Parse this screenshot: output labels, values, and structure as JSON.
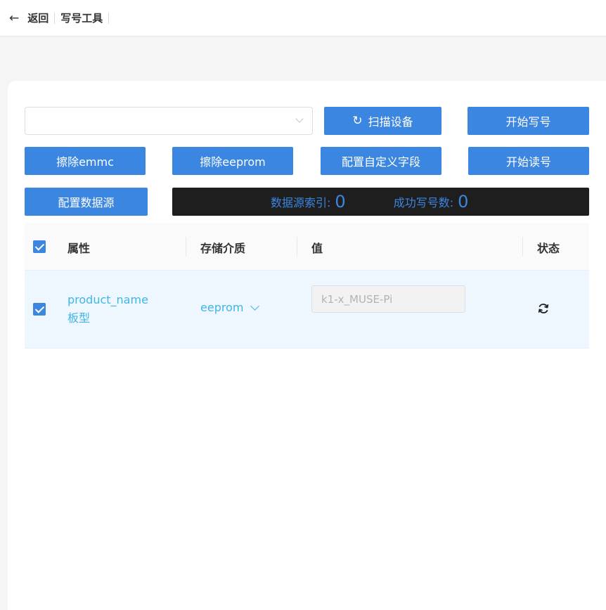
{
  "header": {
    "back_label": "返回",
    "title": "写号工具"
  },
  "device_select": {
    "value": "",
    "placeholder": ""
  },
  "toolbar": {
    "scan_label": "扫描设备",
    "start_write_label": "开始写号",
    "erase_emmc_label": "擦除emmc",
    "erase_eeprom_label": "擦除eeprom",
    "config_custom_label": "配置自定义字段",
    "start_read_label": "开始读号",
    "config_datasource_label": "配置数据源"
  },
  "stats": {
    "index_label": "数据源索引:",
    "index_value": "0",
    "success_label": "成功写号数:",
    "success_value": "0"
  },
  "table": {
    "headers": {
      "property": "属性",
      "storage": "存储介质",
      "value": "值",
      "status": "状态"
    },
    "rows": [
      {
        "checked": true,
        "property_key": "product_name",
        "property_name": "板型",
        "storage": "eeprom",
        "value": "k1-x_MUSE-Pi",
        "status_icon": "refresh-icon"
      }
    ]
  },
  "colors": {
    "primary": "#3b86e0",
    "link": "#3fb6e8",
    "stats_bg": "#1e1e1e",
    "row_selected_bg": "#eef6fe"
  }
}
